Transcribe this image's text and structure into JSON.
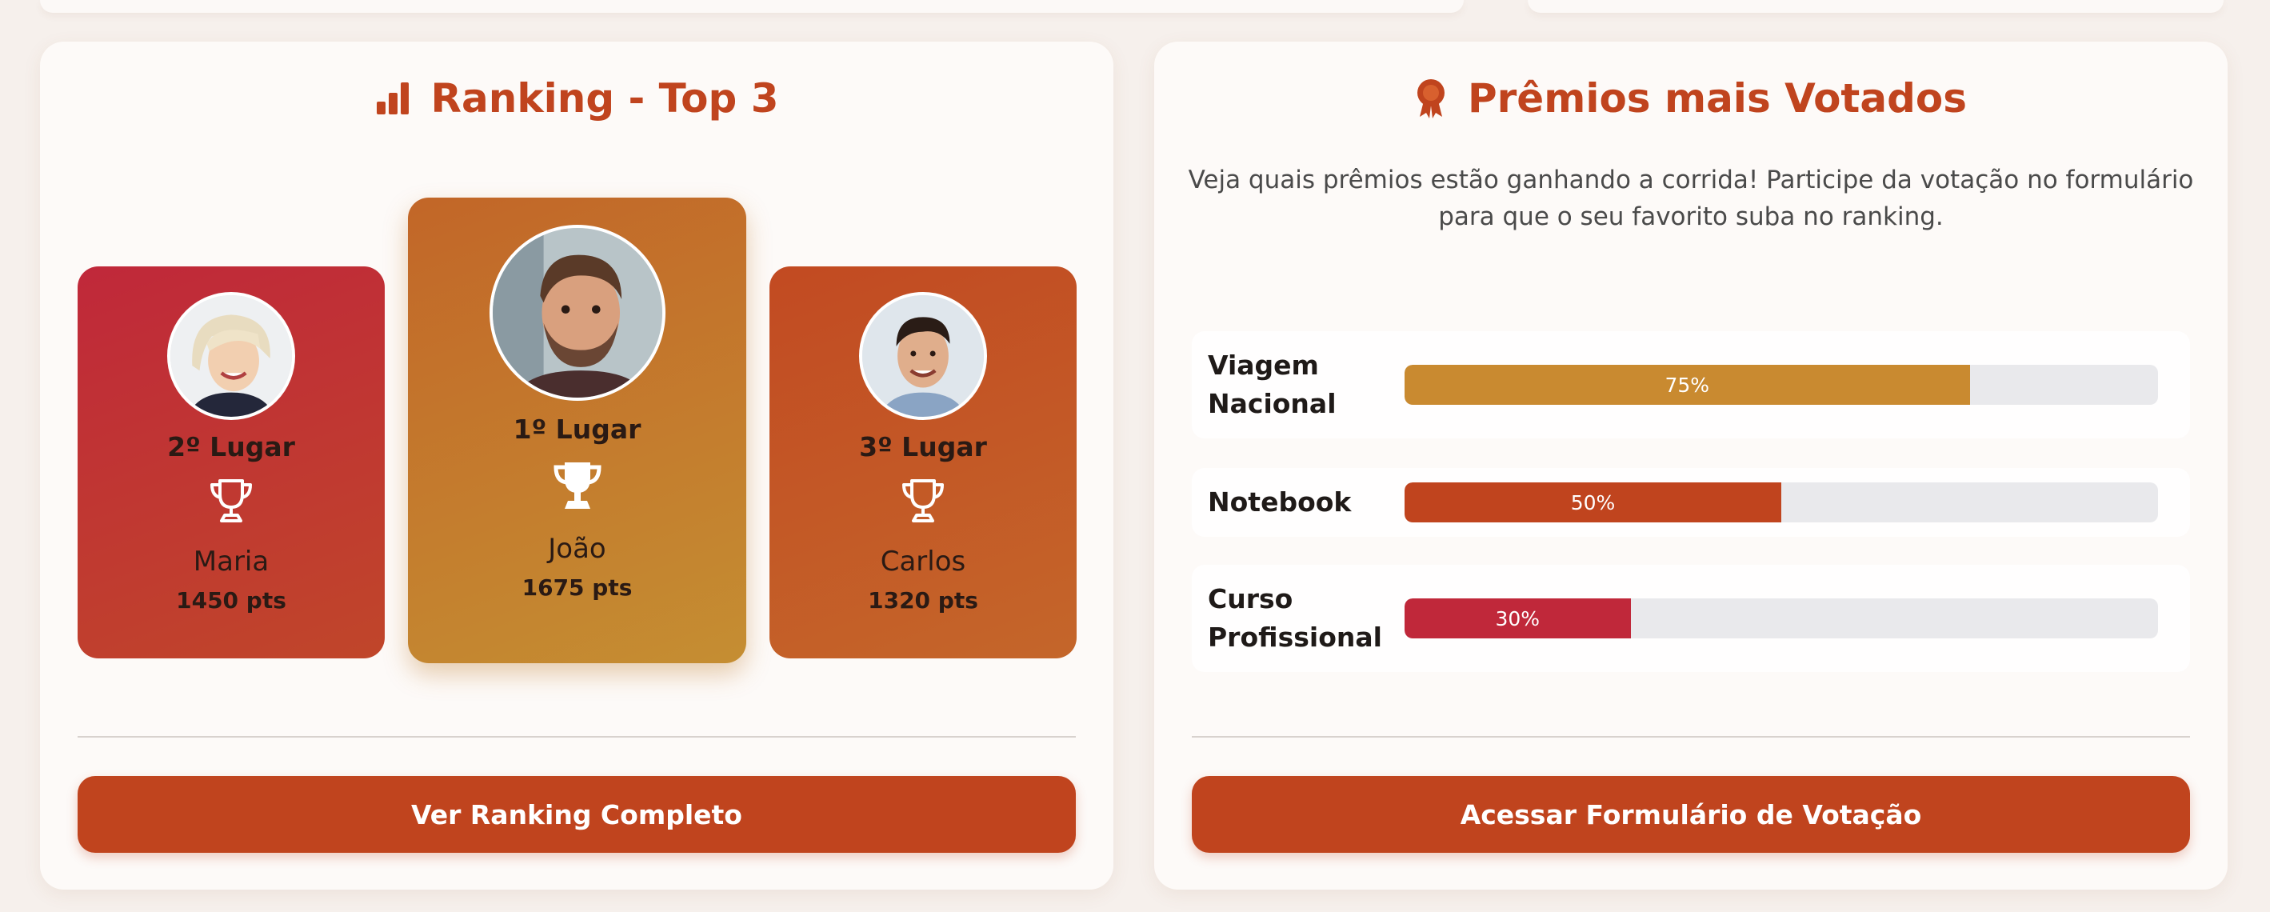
{
  "ranking": {
    "title": "Ranking - Top 3",
    "title_icon": "bar-chart-icon",
    "accent_color": "#c0441e",
    "podium": [
      {
        "place": "2º Lugar",
        "name": "Maria",
        "points": "1450 pts",
        "icon": "trophy-outline-icon"
      },
      {
        "place": "1º Lugar",
        "name": "João",
        "points": "1675 pts",
        "icon": "trophy-solid-icon"
      },
      {
        "place": "3º Lugar",
        "name": "Carlos",
        "points": "1320 pts",
        "icon": "trophy-outline-icon"
      }
    ],
    "button_label": "Ver Ranking Completo"
  },
  "prizes": {
    "title": "Prêmios mais Votados",
    "title_icon": "award-ribbon-icon",
    "subtitle": "Veja quais prêmios estão ganhando a corrida! Participe da votação no formulário para que o seu favorito suba no ranking.",
    "items": [
      {
        "label": "Viagem Nacional",
        "percent_label": "75%",
        "percent": 75,
        "color": "#c98a30"
      },
      {
        "label": "Notebook",
        "percent_label": "50%",
        "percent": 50,
        "color": "#c0441e"
      },
      {
        "label": "Curso Profissional",
        "percent_label": "30%",
        "percent": 30,
        "color": "#c0283a"
      }
    ],
    "button_label": "Acessar Formulário de Votação"
  }
}
